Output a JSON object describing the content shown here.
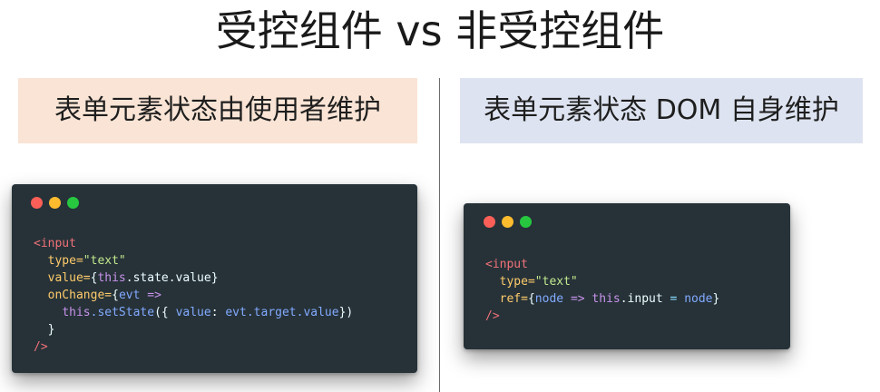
{
  "title": "受控组件 vs 非受控组件",
  "left": {
    "banner": "表单元素状态由使用者维护",
    "code": {
      "l1_tag": "<input",
      "l2_attr": "type=",
      "l2_str": "\"text\"",
      "l3_attr": "value=",
      "l3_open": "{",
      "l3_kw": "this",
      "l3_rest": ".state.value",
      "l3_close": "}",
      "l4_attr": "onChange=",
      "l4_open": "{",
      "l4_param": "evt",
      "l4_arrow": "=>",
      "l5_kw": "this",
      "l5_call": ".setState",
      "l5_open": "({ ",
      "l5_key": "value",
      "l5_colon": ": ",
      "l5_val": "evt.target.value",
      "l5_close": "})",
      "l6_close": "}",
      "l7_tag": "/>"
    }
  },
  "right": {
    "banner": "表单元素状态 DOM 自身维护",
    "code": {
      "l1_tag": "<input",
      "l2_attr": "type=",
      "l2_str": "\"text\"",
      "l3_attr": "ref=",
      "l3_open": "{",
      "l3_param": "node",
      "l3_arrow": "=>",
      "l3_kw": "this",
      "l3_prop": ".input",
      "l3_eq": "=",
      "l3_val": "node",
      "l3_close": "}",
      "l4_tag": "/>"
    }
  },
  "window_controls": [
    "red-dot",
    "yellow-dot",
    "green-dot"
  ],
  "colors": {
    "left_banner_bg": "#f9e4d5",
    "right_banner_bg": "#dde3f0",
    "code_bg": "#263238",
    "tag": "#f07178",
    "attr": "#ffcb6b",
    "string": "#c3e88d",
    "keyword": "#c792ea",
    "function": "#82aaff"
  }
}
